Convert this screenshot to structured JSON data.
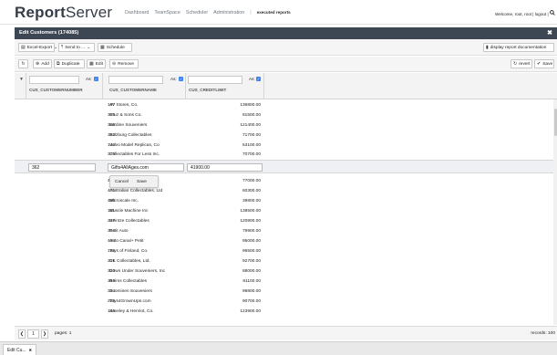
{
  "app": {
    "brand_bold": "Report",
    "brand_light": "Server"
  },
  "nav": {
    "items": [
      "Dashboard",
      "TeamSpace",
      "Scheduler",
      "Administration"
    ],
    "separator": "|",
    "current": "executed reports"
  },
  "user": {
    "text": "Welcome, root, root | logout | "
  },
  "window": {
    "title": "Edit Customers (174085)",
    "close": "✖"
  },
  "toolbar1": {
    "export_label": "Excel-Export",
    "send_label": "Send to ...",
    "schedule_label": "Schedule",
    "doc_label": "display report documentation"
  },
  "toolbar2": {
    "add_label": "Add",
    "duplicate_label": "Duplicate",
    "edit_label": "Edit",
    "remove_label": "Remove",
    "revert_label": "revert",
    "save_label": "Save"
  },
  "grid": {
    "filter_as_label": "As:",
    "columns": [
      "CUS_CUSTOMERNUMBER",
      "CUS_CUSTOMERNAME",
      "CUS_CREDITLIMIT"
    ],
    "rows_top": [
      {
        "num": "187",
        "name": "AV Stores, Co.",
        "credit": "136800.00"
      },
      {
        "num": "385",
        "name": "Cruz & Sons Co.",
        "credit": "81500.00"
      },
      {
        "num": "386",
        "name": "Lordine Souveniers",
        "credit": "121400.00"
      },
      {
        "num": "382",
        "name": "Salzburg Collectables",
        "credit": "71700.00"
      },
      {
        "num": "144",
        "name": "Volvo Model Replicas, Co",
        "credit": "53100.00"
      },
      {
        "num": "379",
        "name": "Collectables For Less Inc.",
        "credit": "70700.00"
      }
    ],
    "edit_row": {
      "num": "362",
      "name": "Gifts4AllAges.com",
      "credit": "41900.00"
    },
    "popup": {
      "cancel": "Cancel",
      "save": "Save"
    },
    "rows_bottom": [
      {
        "num": "415",
        "name": "Bava                  nports, ...",
        "credit": "77000.00"
      },
      {
        "num": "471",
        "name": "Australian Collectables, Ltd",
        "credit": "60300.00"
      },
      {
        "num": "456",
        "name": "Microscale Inc.",
        "credit": "39800.00"
      },
      {
        "num": "151",
        "name": "Muscle Machine Inc",
        "credit": "138500.00"
      },
      {
        "num": "227",
        "name": "Heintze Collectables",
        "credit": "120800.00"
      },
      {
        "num": "314",
        "name": "Petit Auto",
        "credit": "79900.00"
      },
      {
        "num": "406",
        "name": "Auto Canal+ Petit",
        "credit": "95000.00"
      },
      {
        "num": "186",
        "name": "Toys of Finland, Co.",
        "credit": "96500.00"
      },
      {
        "num": "201",
        "name": "UK Collectables, Ltd.",
        "credit": "92700.00"
      },
      {
        "num": "323",
        "name": "Down Under Souveniers, Inc",
        "credit": "88000.00"
      },
      {
        "num": "353",
        "name": "Reims Collectables",
        "credit": "81100.00"
      },
      {
        "num": "334",
        "name": "Suominen Souveniers",
        "credit": "98800.00"
      },
      {
        "num": "205",
        "name": "Toys4GrownUps.com",
        "credit": "90700.00"
      },
      {
        "num": "146",
        "name": "Saveley & Henriot, Co.",
        "credit": "123900.00"
      }
    ]
  },
  "pager": {
    "prev": "❮",
    "page": "1",
    "next": "❯",
    "pages_label": "pages: 1",
    "records_label": "records: 100"
  },
  "bottom_tab": {
    "label": "Edit Cu...",
    "close": "✖"
  }
}
